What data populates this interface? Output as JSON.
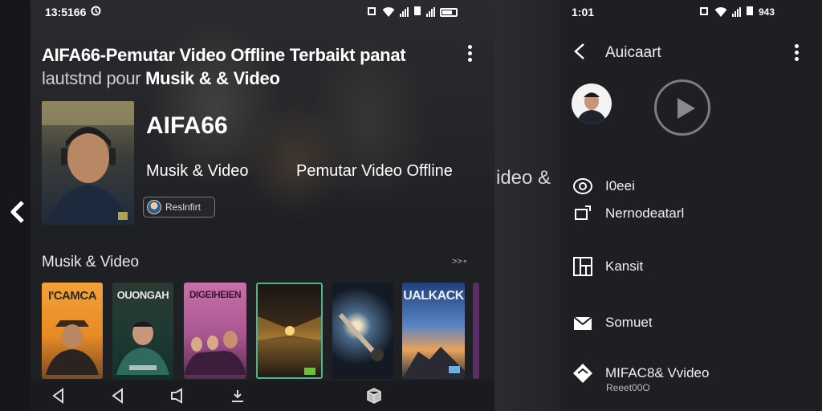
{
  "status_left": {
    "time": "13:5166"
  },
  "status_right": {
    "time": "1:01",
    "battery": "943"
  },
  "left_screen": {
    "title_line1": "AIFA66-Pemutar Video Offline Terbaikt panat",
    "title_line2_prefix": "lautstnd pour",
    "title_line2_bold": "Musik & & Video",
    "hero": {
      "name": "AIFA66",
      "subtitle_left": "Musik & Video",
      "subtitle_right": "Pemutar Video Offline",
      "chip_label": "Reslnfirt"
    },
    "section_title": "Musik & Video",
    "see_all": ">>∘",
    "cards": [
      {
        "title": "I'CAMCA"
      },
      {
        "title": "OUONGAH"
      },
      {
        "title": "DIGEIHEIEN"
      },
      {
        "title": ""
      },
      {
        "title": ""
      },
      {
        "title": "UALKACK"
      }
    ]
  },
  "middle": {
    "text": "ideo &"
  },
  "right_screen": {
    "title": "Auicaart",
    "menu": [
      {
        "label": "I0eei",
        "icon": "at-icon"
      },
      {
        "label": "Nernodeatarl",
        "icon": "crop-icon"
      },
      {
        "label": "Kansit",
        "icon": "layout-icon"
      },
      {
        "label": "Somuet",
        "icon": "mail-icon"
      },
      {
        "label": "MIFAC8& Vvideo",
        "icon": "diamond-icon"
      }
    ],
    "footer_sub": "Reeet00O"
  },
  "colors": {
    "accent": "#4fb58a",
    "background": "#1e2024"
  }
}
